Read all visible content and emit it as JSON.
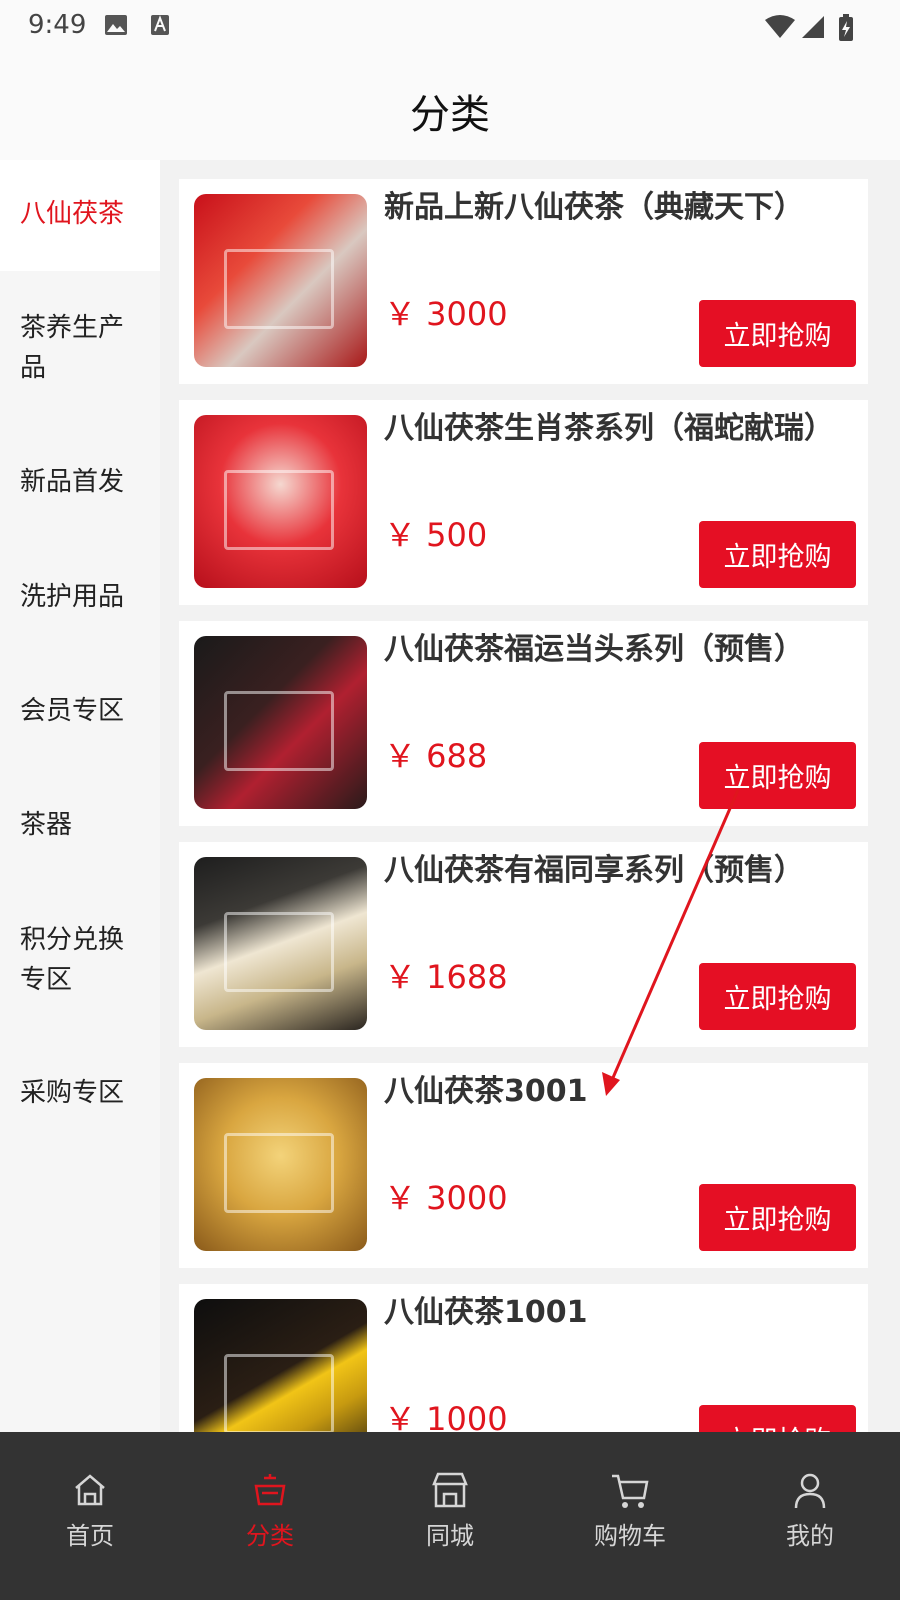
{
  "status_bar": {
    "time": "9:49"
  },
  "header": {
    "title": "分类"
  },
  "sidebar": {
    "items": [
      {
        "label": "八仙茯茶",
        "active": true
      },
      {
        "label": "茶养生产品",
        "active": false
      },
      {
        "label": "新品首发",
        "active": false
      },
      {
        "label": "洗护用品",
        "active": false
      },
      {
        "label": "会员专区",
        "active": false
      },
      {
        "label": "茶器",
        "active": false
      },
      {
        "label": "积分兑换专区",
        "active": false
      },
      {
        "label": "采购专区",
        "active": false
      }
    ]
  },
  "products": [
    {
      "name": "新品上新八仙茯茶（典藏天下）",
      "price": "￥ 3000",
      "button": "立即抢购"
    },
    {
      "name": "八仙茯茶生肖茶系列（福蛇献瑞）",
      "price": "￥ 500",
      "button": "立即抢购"
    },
    {
      "name": "八仙茯茶福运当头系列（预售）",
      "price": "￥ 688",
      "button": "立即抢购"
    },
    {
      "name": "八仙茯茶有福同享系列（预售）",
      "price": "￥ 1688",
      "button": "立即抢购"
    },
    {
      "name": "八仙茯茶3001",
      "price": "￥ 3000",
      "button": "立即抢购"
    },
    {
      "name": "八仙茯茶1001",
      "price": "￥ 1000",
      "button": "立即抢购"
    }
  ],
  "tabbar": {
    "items": [
      {
        "label": "首页",
        "icon": "home-icon",
        "active": false
      },
      {
        "label": "分类",
        "icon": "category-teapot-icon",
        "active": true
      },
      {
        "label": "同城",
        "icon": "store-icon",
        "active": false
      },
      {
        "label": "购物车",
        "icon": "cart-icon",
        "active": false
      },
      {
        "label": "我的",
        "icon": "profile-icon",
        "active": false
      }
    ]
  },
  "colors": {
    "accent": "#e0151e",
    "button": "#e50f24",
    "tabbar_bg": "#333333"
  }
}
